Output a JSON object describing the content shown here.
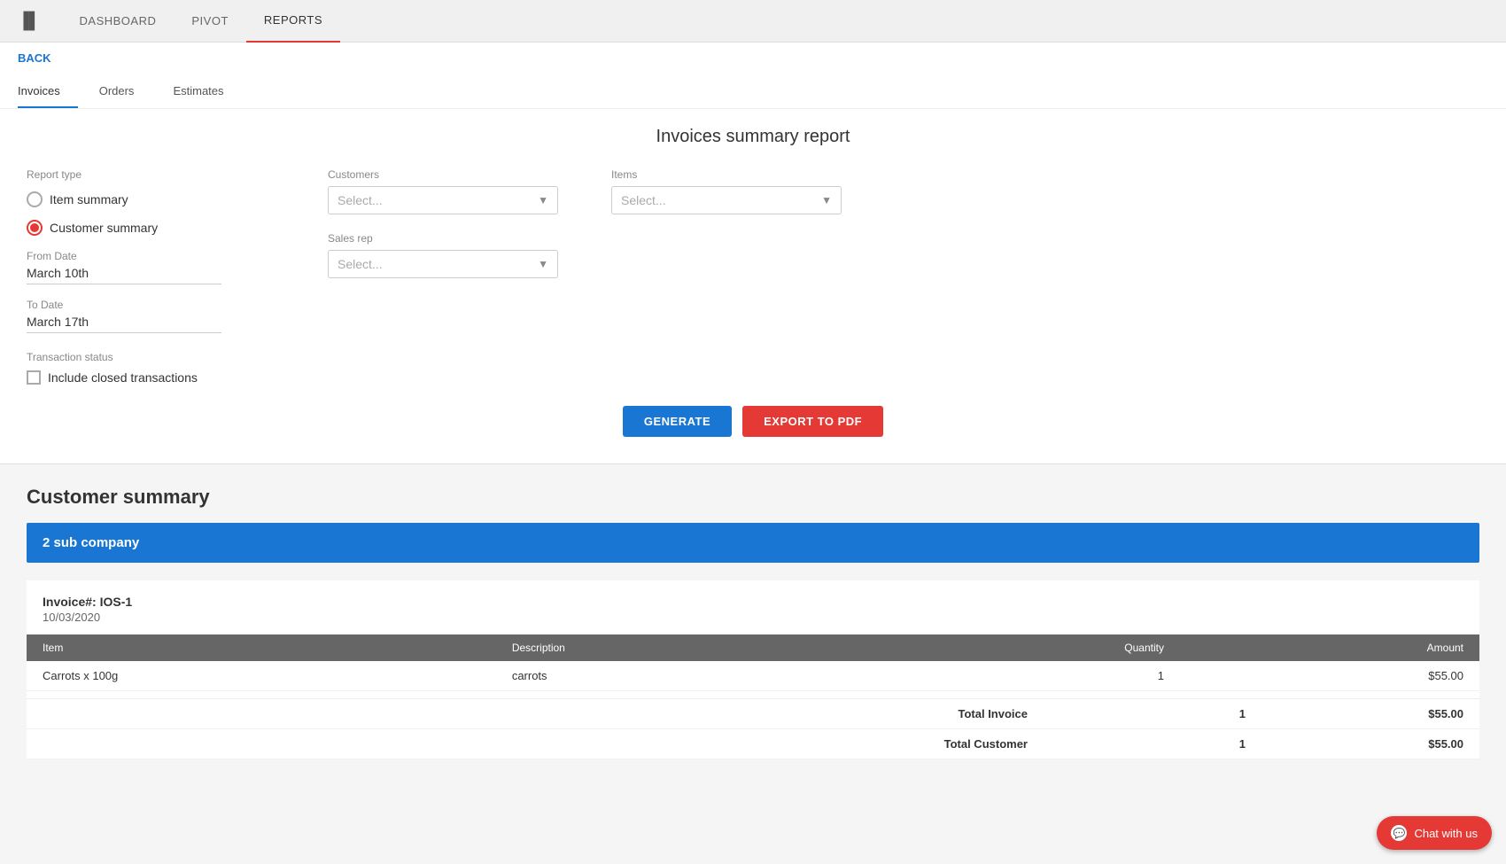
{
  "topNav": {
    "icon": "▐▌",
    "items": [
      {
        "label": "DASHBOARD",
        "active": false
      },
      {
        "label": "PIVOT",
        "active": false
      },
      {
        "label": "REPORTS",
        "active": true
      }
    ]
  },
  "backLink": "BACK",
  "subTabs": [
    {
      "label": "Invoices",
      "active": true
    },
    {
      "label": "Orders",
      "active": false
    },
    {
      "label": "Estimates",
      "active": false
    }
  ],
  "reportForm": {
    "title": "Invoices summary report",
    "reportTypeLabel": "Report type",
    "radioOptions": [
      {
        "label": "Item summary",
        "selected": false
      },
      {
        "label": "Customer summary",
        "selected": true
      }
    ],
    "fromDate": {
      "label": "From Date",
      "value": "March 10th"
    },
    "toDate": {
      "label": "To Date",
      "value": "March 17th"
    },
    "transactionStatus": {
      "label": "Transaction status",
      "checkboxLabel": "Include closed transactions",
      "checked": false
    },
    "customers": {
      "label": "Customers",
      "placeholder": "Select..."
    },
    "salesRep": {
      "label": "Sales rep",
      "placeholder": "Select..."
    },
    "items": {
      "label": "Items",
      "placeholder": "Select..."
    },
    "generateButton": "GENERATE",
    "exportButton": "EXPORT TO PDF"
  },
  "results": {
    "title": "Customer summary",
    "companyBanner": "2 sub company",
    "invoice": {
      "number": "Invoice#: IOS-1",
      "date": "10/03/2020",
      "tableHeaders": [
        "Item",
        "Description",
        "Quantity",
        "Amount"
      ],
      "rows": [
        {
          "item": "Carrots x 100g",
          "description": "carrots",
          "quantity": "1",
          "amount": "$55.00"
        }
      ],
      "totalInvoice": {
        "label": "Total Invoice",
        "quantity": "1",
        "amount": "$55.00"
      },
      "totalCustomer": {
        "label": "Total Customer",
        "quantity": "1",
        "amount": "$55.00"
      }
    }
  },
  "chat": {
    "label": "Chat with us"
  }
}
